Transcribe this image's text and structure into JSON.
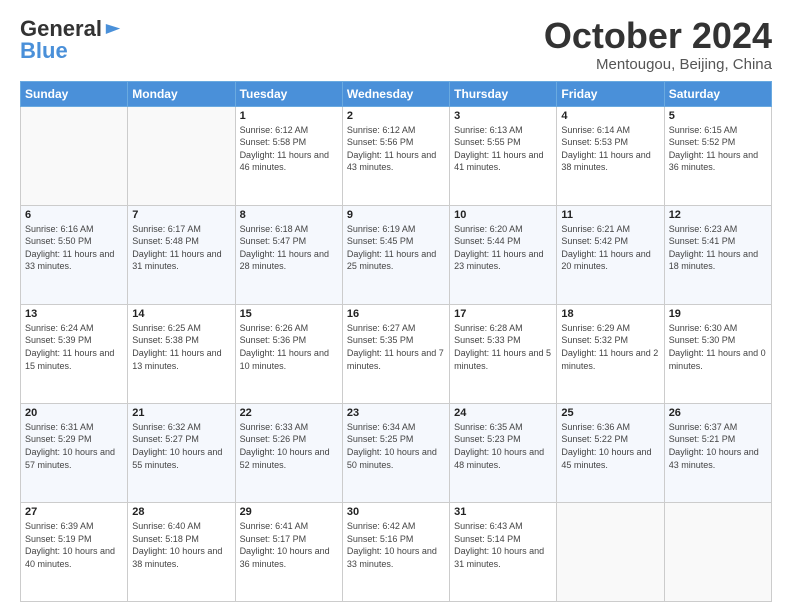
{
  "logo": {
    "part1": "General",
    "part2": "Blue"
  },
  "title": "October 2024",
  "subtitle": "Mentougou, Beijing, China",
  "weekdays": [
    "Sunday",
    "Monday",
    "Tuesday",
    "Wednesday",
    "Thursday",
    "Friday",
    "Saturday"
  ],
  "weeks": [
    [
      {
        "day": "",
        "info": ""
      },
      {
        "day": "",
        "info": ""
      },
      {
        "day": "1",
        "info": "Sunrise: 6:12 AM\nSunset: 5:58 PM\nDaylight: 11 hours and 46 minutes."
      },
      {
        "day": "2",
        "info": "Sunrise: 6:12 AM\nSunset: 5:56 PM\nDaylight: 11 hours and 43 minutes."
      },
      {
        "day": "3",
        "info": "Sunrise: 6:13 AM\nSunset: 5:55 PM\nDaylight: 11 hours and 41 minutes."
      },
      {
        "day": "4",
        "info": "Sunrise: 6:14 AM\nSunset: 5:53 PM\nDaylight: 11 hours and 38 minutes."
      },
      {
        "day": "5",
        "info": "Sunrise: 6:15 AM\nSunset: 5:52 PM\nDaylight: 11 hours and 36 minutes."
      }
    ],
    [
      {
        "day": "6",
        "info": "Sunrise: 6:16 AM\nSunset: 5:50 PM\nDaylight: 11 hours and 33 minutes."
      },
      {
        "day": "7",
        "info": "Sunrise: 6:17 AM\nSunset: 5:48 PM\nDaylight: 11 hours and 31 minutes."
      },
      {
        "day": "8",
        "info": "Sunrise: 6:18 AM\nSunset: 5:47 PM\nDaylight: 11 hours and 28 minutes."
      },
      {
        "day": "9",
        "info": "Sunrise: 6:19 AM\nSunset: 5:45 PM\nDaylight: 11 hours and 25 minutes."
      },
      {
        "day": "10",
        "info": "Sunrise: 6:20 AM\nSunset: 5:44 PM\nDaylight: 11 hours and 23 minutes."
      },
      {
        "day": "11",
        "info": "Sunrise: 6:21 AM\nSunset: 5:42 PM\nDaylight: 11 hours and 20 minutes."
      },
      {
        "day": "12",
        "info": "Sunrise: 6:23 AM\nSunset: 5:41 PM\nDaylight: 11 hours and 18 minutes."
      }
    ],
    [
      {
        "day": "13",
        "info": "Sunrise: 6:24 AM\nSunset: 5:39 PM\nDaylight: 11 hours and 15 minutes."
      },
      {
        "day": "14",
        "info": "Sunrise: 6:25 AM\nSunset: 5:38 PM\nDaylight: 11 hours and 13 minutes."
      },
      {
        "day": "15",
        "info": "Sunrise: 6:26 AM\nSunset: 5:36 PM\nDaylight: 11 hours and 10 minutes."
      },
      {
        "day": "16",
        "info": "Sunrise: 6:27 AM\nSunset: 5:35 PM\nDaylight: 11 hours and 7 minutes."
      },
      {
        "day": "17",
        "info": "Sunrise: 6:28 AM\nSunset: 5:33 PM\nDaylight: 11 hours and 5 minutes."
      },
      {
        "day": "18",
        "info": "Sunrise: 6:29 AM\nSunset: 5:32 PM\nDaylight: 11 hours and 2 minutes."
      },
      {
        "day": "19",
        "info": "Sunrise: 6:30 AM\nSunset: 5:30 PM\nDaylight: 11 hours and 0 minutes."
      }
    ],
    [
      {
        "day": "20",
        "info": "Sunrise: 6:31 AM\nSunset: 5:29 PM\nDaylight: 10 hours and 57 minutes."
      },
      {
        "day": "21",
        "info": "Sunrise: 6:32 AM\nSunset: 5:27 PM\nDaylight: 10 hours and 55 minutes."
      },
      {
        "day": "22",
        "info": "Sunrise: 6:33 AM\nSunset: 5:26 PM\nDaylight: 10 hours and 52 minutes."
      },
      {
        "day": "23",
        "info": "Sunrise: 6:34 AM\nSunset: 5:25 PM\nDaylight: 10 hours and 50 minutes."
      },
      {
        "day": "24",
        "info": "Sunrise: 6:35 AM\nSunset: 5:23 PM\nDaylight: 10 hours and 48 minutes."
      },
      {
        "day": "25",
        "info": "Sunrise: 6:36 AM\nSunset: 5:22 PM\nDaylight: 10 hours and 45 minutes."
      },
      {
        "day": "26",
        "info": "Sunrise: 6:37 AM\nSunset: 5:21 PM\nDaylight: 10 hours and 43 minutes."
      }
    ],
    [
      {
        "day": "27",
        "info": "Sunrise: 6:39 AM\nSunset: 5:19 PM\nDaylight: 10 hours and 40 minutes."
      },
      {
        "day": "28",
        "info": "Sunrise: 6:40 AM\nSunset: 5:18 PM\nDaylight: 10 hours and 38 minutes."
      },
      {
        "day": "29",
        "info": "Sunrise: 6:41 AM\nSunset: 5:17 PM\nDaylight: 10 hours and 36 minutes."
      },
      {
        "day": "30",
        "info": "Sunrise: 6:42 AM\nSunset: 5:16 PM\nDaylight: 10 hours and 33 minutes."
      },
      {
        "day": "31",
        "info": "Sunrise: 6:43 AM\nSunset: 5:14 PM\nDaylight: 10 hours and 31 minutes."
      },
      {
        "day": "",
        "info": ""
      },
      {
        "day": "",
        "info": ""
      }
    ]
  ]
}
